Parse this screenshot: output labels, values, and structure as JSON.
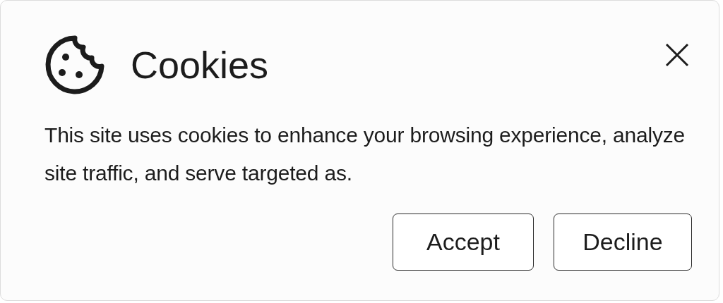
{
  "dialog": {
    "title": "Cookies",
    "message": "This site uses cookies to enhance your browsing experience, analyze site traffic, and serve targeted as.",
    "buttons": [
      {
        "label": "Accept"
      },
      {
        "label": "Decline"
      }
    ]
  }
}
